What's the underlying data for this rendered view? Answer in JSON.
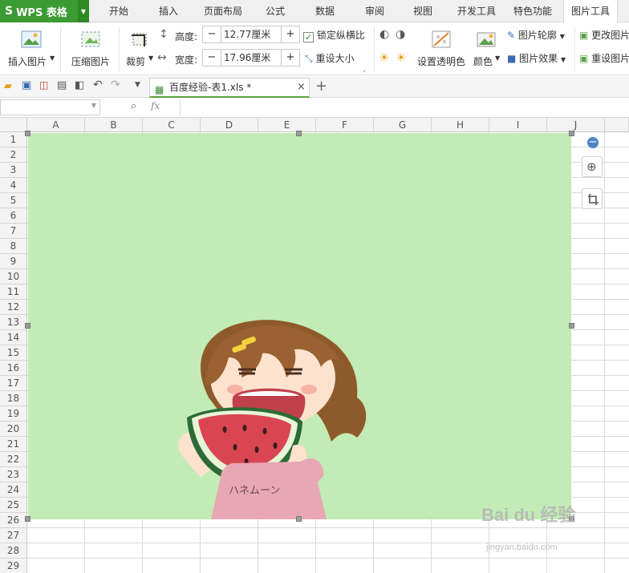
{
  "app": {
    "name": "WPS 表格",
    "logo": "S"
  },
  "menu_tabs": [
    "开始",
    "插入",
    "页面布局",
    "公式",
    "数据",
    "审阅",
    "视图",
    "开发工具",
    "特色功能",
    "图片工具"
  ],
  "active_tab": "图片工具",
  "ribbon": {
    "insert_picture": "插入图片",
    "compress_picture": "压缩图片",
    "crop": "裁剪",
    "height_label": "高度:",
    "height_value": "12.77厘米",
    "width_label": "宽度:",
    "width_value": "17.96厘米",
    "lock_ratio": "锁定纵横比",
    "lock_ratio_checked": true,
    "reset_size": "重设大小",
    "set_transparent": "设置透明色",
    "color": "颜色",
    "picture_outline": "图片轮廓",
    "picture_effect": "图片效果",
    "change_picture": "更改图片",
    "reset_picture": "重设图片"
  },
  "document_tab": {
    "filename": "百度经验-表1.xls *"
  },
  "formula_bar": {
    "fx": "fx"
  },
  "columns": [
    "A",
    "B",
    "C",
    "D",
    "E",
    "F",
    "G",
    "H",
    "I",
    "J"
  ],
  "rows": [
    "1",
    "2",
    "3",
    "4",
    "5",
    "6",
    "7",
    "8",
    "9",
    "10",
    "11",
    "12",
    "13",
    "14",
    "15",
    "16",
    "17",
    "18",
    "19",
    "20",
    "21",
    "22",
    "23",
    "24",
    "25",
    "26",
    "27",
    "28",
    "29"
  ],
  "picture": {
    "background": "#c3ebb6",
    "shirt_text": "ハネムーン"
  },
  "watermark": {
    "brand": "Bai du 经验",
    "url": "jingyan.baidu.com"
  },
  "colors": {
    "accent": "#3c9a32",
    "picture_bg": "#c3ebb6"
  }
}
